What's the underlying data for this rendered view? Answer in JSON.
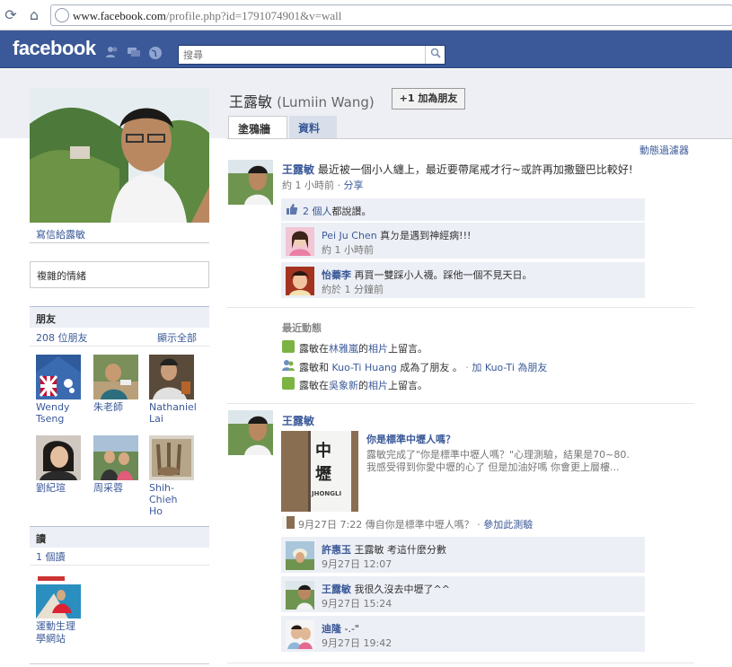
{
  "browser": {
    "url_host": "www.facebook.com",
    "url_path": "/profile.php?id=1791074901&v=wall"
  },
  "header": {
    "logo": "facebook",
    "search_placeholder": "搜尋"
  },
  "profile": {
    "name": "王露敏",
    "alt_name": "(Lumiin Wang)",
    "add_friend_label": "+1 加為朋友",
    "tabs": [
      "塗鴉牆",
      "資料"
    ],
    "message_link": "寫信給露敏",
    "status_box": "複雜的情緒"
  },
  "friends_box": {
    "title": "朋友",
    "count": "208 位朋友",
    "see_all": "顯示全部",
    "friends": [
      {
        "name": "Wendy Tseng",
        "line1": "Wendy",
        "line2": "Tseng"
      },
      {
        "name": "朱老師",
        "line1": "朱老師",
        "line2": ""
      },
      {
        "name": "Nathaniel Lai",
        "line1": "Nathaniel",
        "line2": "Lai"
      },
      {
        "name": "劉紀瑄",
        "line1": "劉紀瑄",
        "line2": ""
      },
      {
        "name": "周采蓉",
        "line1": "周采蓉",
        "line2": ""
      },
      {
        "name": "Shih-Chieh Ho",
        "line1": "Shih-Chieh",
        "line2": "Ho"
      }
    ]
  },
  "reads_box": {
    "title": "讀",
    "count": "1 個讀",
    "item_line1": "運動生理",
    "item_line2": "學網站"
  },
  "feed": {
    "filter_label": "動態過濾器",
    "post1": {
      "author": "王露敏",
      "text": "最近被一個小人纏上，最近要帶尾戒才行~或許再加撒鹽巴比較好!",
      "time": "約 1 小時前",
      "share": "分享",
      "likes_count": "2 個人",
      "likes_suffix": "都說讚。",
      "comments": [
        {
          "author": "Pei Ju Chen",
          "text": "真ㄉ是遇到神經病!!!",
          "time": "約 1 小時前"
        },
        {
          "author": "怡蓁李",
          "text": "再買一雙踩小人襪。踩他一個不見天日。",
          "time": "約於 1 分鐘前"
        }
      ]
    },
    "recent": {
      "title": "最近動態",
      "items": [
        {
          "prefix": "露敏在",
          "link": "林雅嵐",
          "mid": "的",
          "link2": "相片",
          "suffix": "上留言。"
        },
        {
          "prefix": "露敏和 ",
          "link": "Kuo-Ti Huang",
          "suffix": " 成為了朋友 。",
          "action": "加 Kuo-Ti 為朋友"
        },
        {
          "prefix": "露敏在",
          "link": "吳象新",
          "mid": "的",
          "link2": "相片",
          "suffix": "上留言。"
        }
      ]
    },
    "post2": {
      "author": "王露敏",
      "quiz_title": "你是標準中壢人嗎？",
      "quiz_text1": "露敏完成了\"你是標準中壢人嗎？\"心理測驗，結果是70~80.",
      "quiz_text2": "我感受得到你愛中壢的心了 但是加油好嗎 你會更上層樓...",
      "sign_text": "中壢",
      "sign_small": "JHONGLI",
      "time": "9月27日 7:22 傳自你是標準中壢人嗎？",
      "action": "參加此測驗",
      "comments": [
        {
          "author": "許惠玉",
          "text": "王露敏 考這什麼分數",
          "time": "9月27日 12:07"
        },
        {
          "author": "王露敏",
          "text": "我很久沒去中壢了^^",
          "time": "9月27日 15:24"
        },
        {
          "author": "迪隆",
          "text": "-.-\"",
          "time": "9月27日 19:42"
        }
      ]
    }
  },
  "colors": {
    "brand": "#3b5998",
    "box": "#eceff5",
    "strip": "#edeff4"
  }
}
